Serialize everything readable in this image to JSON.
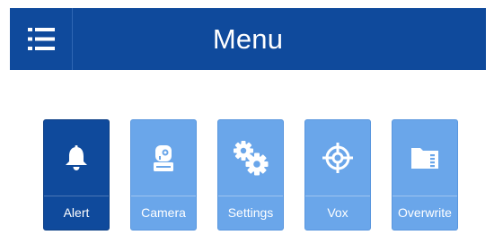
{
  "header": {
    "title": "Menu",
    "menu_icon": "hamburger-menu-icon",
    "background": "#0f4a9c"
  },
  "tiles": [
    {
      "label": "Alert",
      "icon": "bell-icon",
      "active": true
    },
    {
      "label": "Camera",
      "icon": "camera-icon",
      "active": false
    },
    {
      "label": "Settings",
      "icon": "gears-icon",
      "active": false
    },
    {
      "label": "Vox",
      "icon": "crosshair-icon",
      "active": false
    },
    {
      "label": "Overwrite",
      "icon": "sd-card-icon",
      "active": false
    }
  ],
  "colors": {
    "active_tile": "#0f4a9c",
    "inactive_tile": "#6aa6ea"
  }
}
